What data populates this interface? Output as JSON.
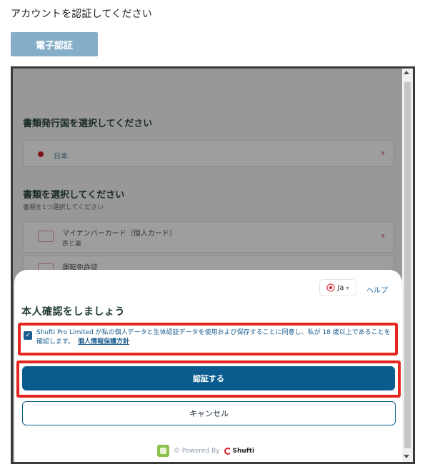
{
  "page": {
    "title": "アカウントを認証してください",
    "top_button_label": "電子認証"
  },
  "background": {
    "heading1": "書類発行国を選択してください",
    "country_value": "日本",
    "heading2": "書類を選択してください",
    "sub2": "書類を1つ選択してください",
    "doc1_label": "マイナンバーカード（個人カード）",
    "doc1_sub": "表と裏",
    "doc2_label": "運転免許証"
  },
  "modal": {
    "language": "Ja",
    "help": "ヘルプ",
    "title": "本人確認をしましょう",
    "consent_text": "Shufti Pro Limited が私の個人データと生体認証データを使用および保存することに同意し、私が 18 歳以上であることを確認します。",
    "privacy_link": "個人情報保護方針",
    "checkbox_checked": true,
    "primary_button": "認証する",
    "cancel_button": "キャンセル",
    "powered_by": "© Powered By",
    "brand": "Shufti"
  },
  "colors": {
    "accent": "#0b5c8e",
    "highlight": "#e4261f",
    "top_button": "#87aec9"
  },
  "icons": [
    "globe-icon",
    "caret-down-icon",
    "checkmark-icon",
    "shufti-logo-icon",
    "green-app-icon",
    "scroll-up-arrow-icon",
    "scroll-down-arrow-icon"
  ]
}
